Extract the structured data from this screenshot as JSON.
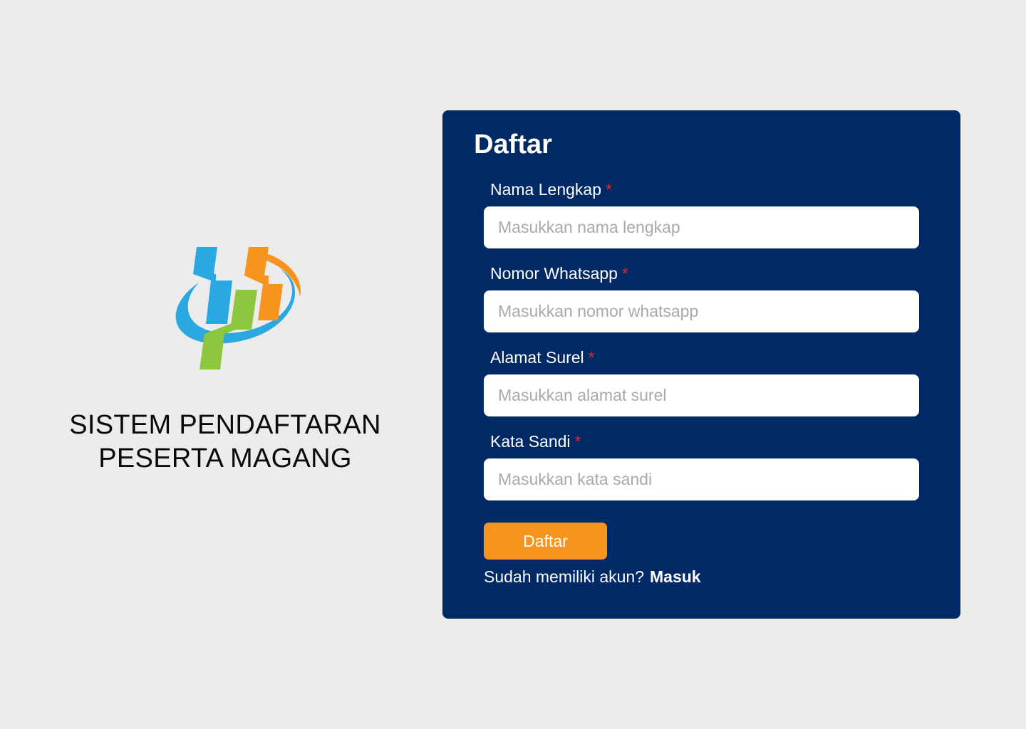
{
  "branding": {
    "logo_name": "bps-logo",
    "title_line1": "SISTEM PENDAFTARAN",
    "title_line2": "PESERTA MAGANG"
  },
  "form": {
    "title": "Daftar",
    "required_marker": "*",
    "fields": [
      {
        "label": "Nama Lengkap",
        "placeholder": "Masukkan nama lengkap",
        "value": ""
      },
      {
        "label": "Nomor Whatsapp",
        "placeholder": "Masukkan nomor whatsapp",
        "value": ""
      },
      {
        "label": "Alamat Surel",
        "placeholder": "Masukkan alamat surel",
        "value": ""
      },
      {
        "label": "Kata Sandi",
        "placeholder": "Masukkan kata sandi",
        "value": ""
      }
    ],
    "submit_label": "Daftar",
    "login_prompt": "Sudah memiliki akun?",
    "login_link": "Masuk"
  },
  "colors": {
    "background": "#ececec",
    "card": "#002966",
    "accent": "#f7941d",
    "required": "#e3262d",
    "logo_blue": "#29a8e1",
    "logo_green": "#8dc63f",
    "logo_orange": "#f7941d"
  }
}
